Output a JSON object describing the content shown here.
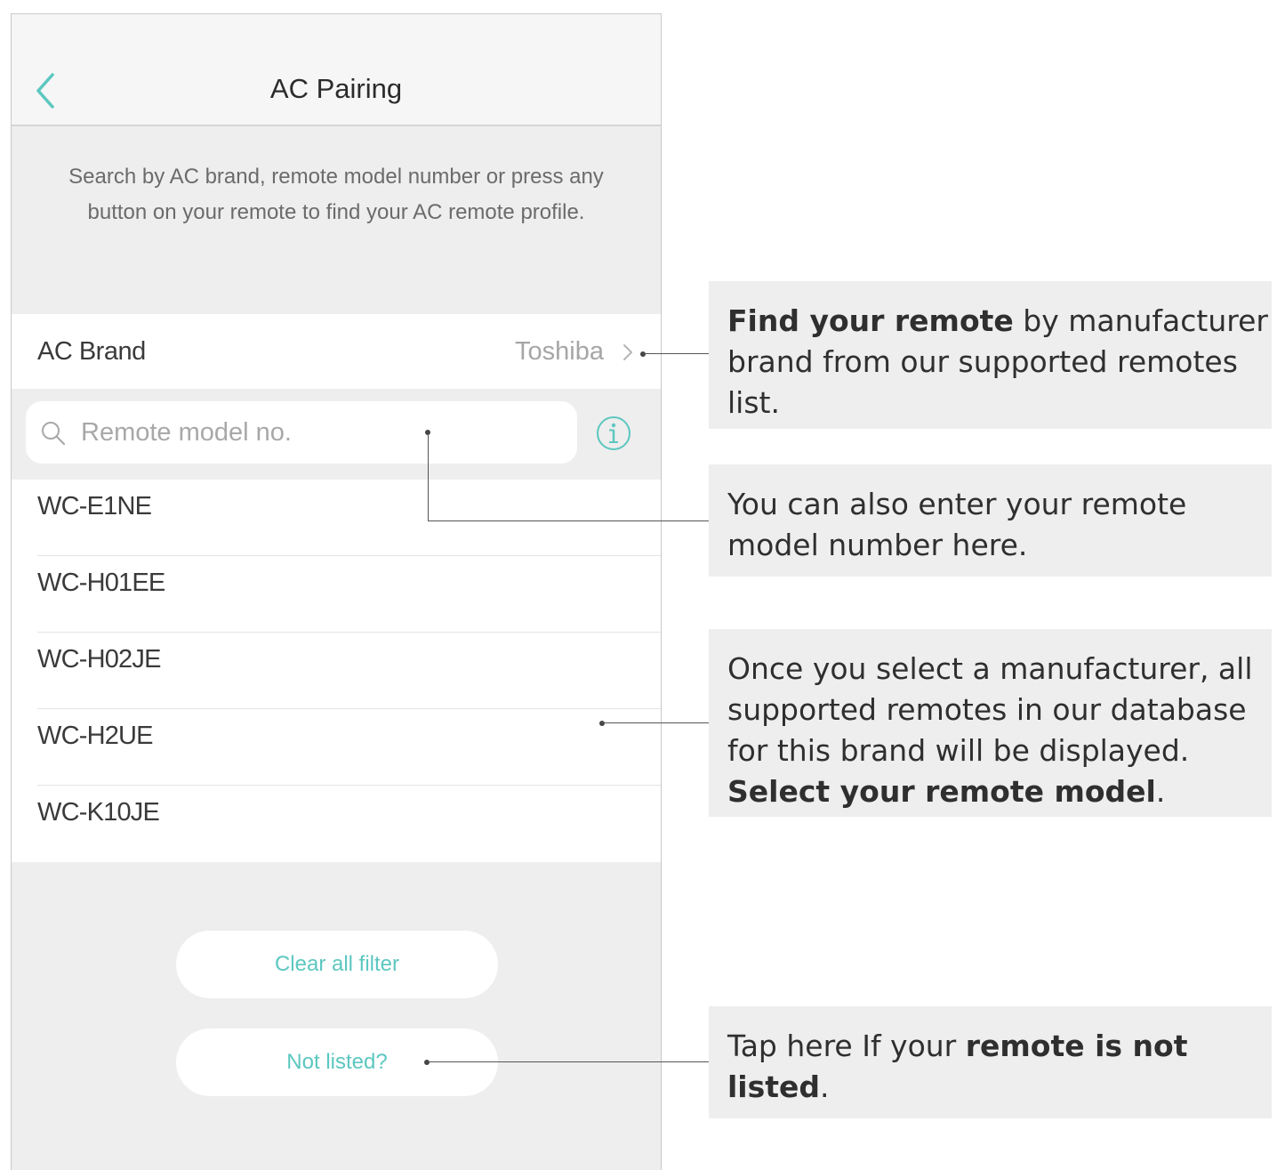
{
  "navbar": {
    "title": "AC Pairing"
  },
  "instructions": {
    "text": "Search by AC brand, remote model number or press any button on your remote to find your AC remote profile."
  },
  "brand": {
    "label": "AC Brand",
    "value": "Toshiba"
  },
  "search": {
    "placeholder": "Remote model no."
  },
  "models": [
    {
      "label": "WC-E1NE"
    },
    {
      "label": "WC-H01EE"
    },
    {
      "label": "WC-H02JE"
    },
    {
      "label": "WC-H2UE"
    },
    {
      "label": "WC-K10JE"
    }
  ],
  "buttons": {
    "clear_label": "Clear all filter",
    "not_listed_label": "Not listed?"
  },
  "callouts": {
    "find_remote": {
      "bold": "Find your remote",
      "rest": " by manufacturer brand from our supported remotes list."
    },
    "enter_model": {
      "text": "You can also enter your remote model number here."
    },
    "select_model": {
      "text": "Once you select a manufacturer, all supported remotes in our database for this brand will be displayed. ",
      "bold": "Select your remote model",
      "end": "."
    },
    "not_listed": {
      "pre": "Tap here If your ",
      "bold": "remote is not listed",
      "end": "."
    }
  },
  "colors": {
    "accent": "#5cc7c0",
    "background": "#eeeeee",
    "text": "#3a3a3a"
  }
}
